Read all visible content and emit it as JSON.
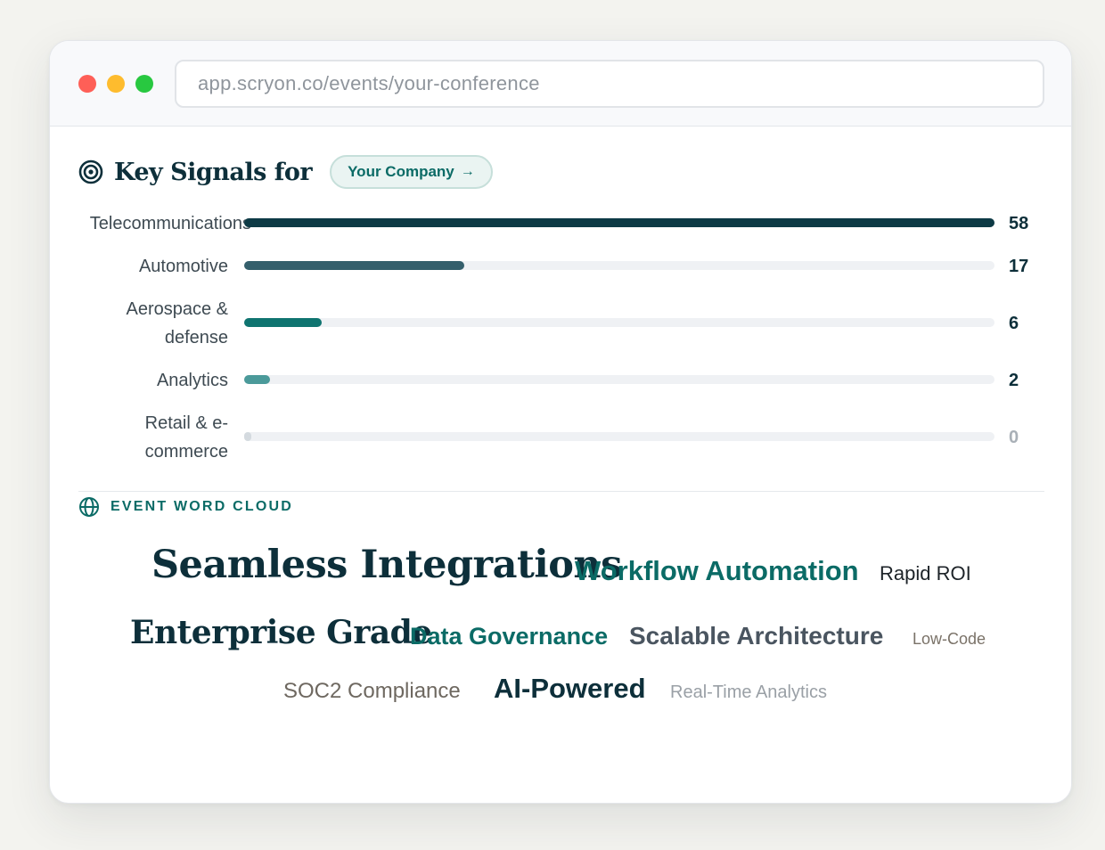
{
  "browser": {
    "url": "app.scryon.co/events/your-conference"
  },
  "signals": {
    "title": "Key Signals for",
    "company_pill": "Your Company",
    "company_arrow": "→",
    "bars": [
      {
        "label": "Telecommunications",
        "value": "58",
        "fraction": 1.0,
        "color": "#0d3a45"
      },
      {
        "label": "Automotive",
        "value": "17",
        "fraction": 0.293,
        "color": "#345f6c"
      },
      {
        "label": "Aerospace & defense",
        "value": "6",
        "fraction": 0.103,
        "color": "#0f7470"
      },
      {
        "label": "Analytics",
        "value": "2",
        "fraction": 0.034,
        "color": "#4b9a9a"
      },
      {
        "label": "Retail & e-commerce",
        "value": "0",
        "fraction": 0.0,
        "color": "#d4dadf"
      }
    ]
  },
  "word_cloud": {
    "title": "EVENT WORD CLOUD",
    "words": [
      {
        "text": "Seamless Integrations",
        "color": "#0d2f3a"
      },
      {
        "text": "Workflow Automation",
        "color": "#0b6b66"
      },
      {
        "text": "Rapid ROI",
        "color": "#1d2328"
      },
      {
        "text": "Enterprise Grade",
        "color": "#0d2f3a"
      },
      {
        "text": "Data Governance",
        "color": "#0b6b66"
      },
      {
        "text": "Scalable Architecture",
        "color": "#4a5560"
      },
      {
        "text": "Low-Code",
        "color": "#7a7268"
      },
      {
        "text": "SOC2 Compliance",
        "color": "#6e6860"
      },
      {
        "text": "AI-Powered",
        "color": "#0d2f3a"
      },
      {
        "text": "Real-Time Analytics",
        "color": "#9aa0a6"
      }
    ]
  }
}
